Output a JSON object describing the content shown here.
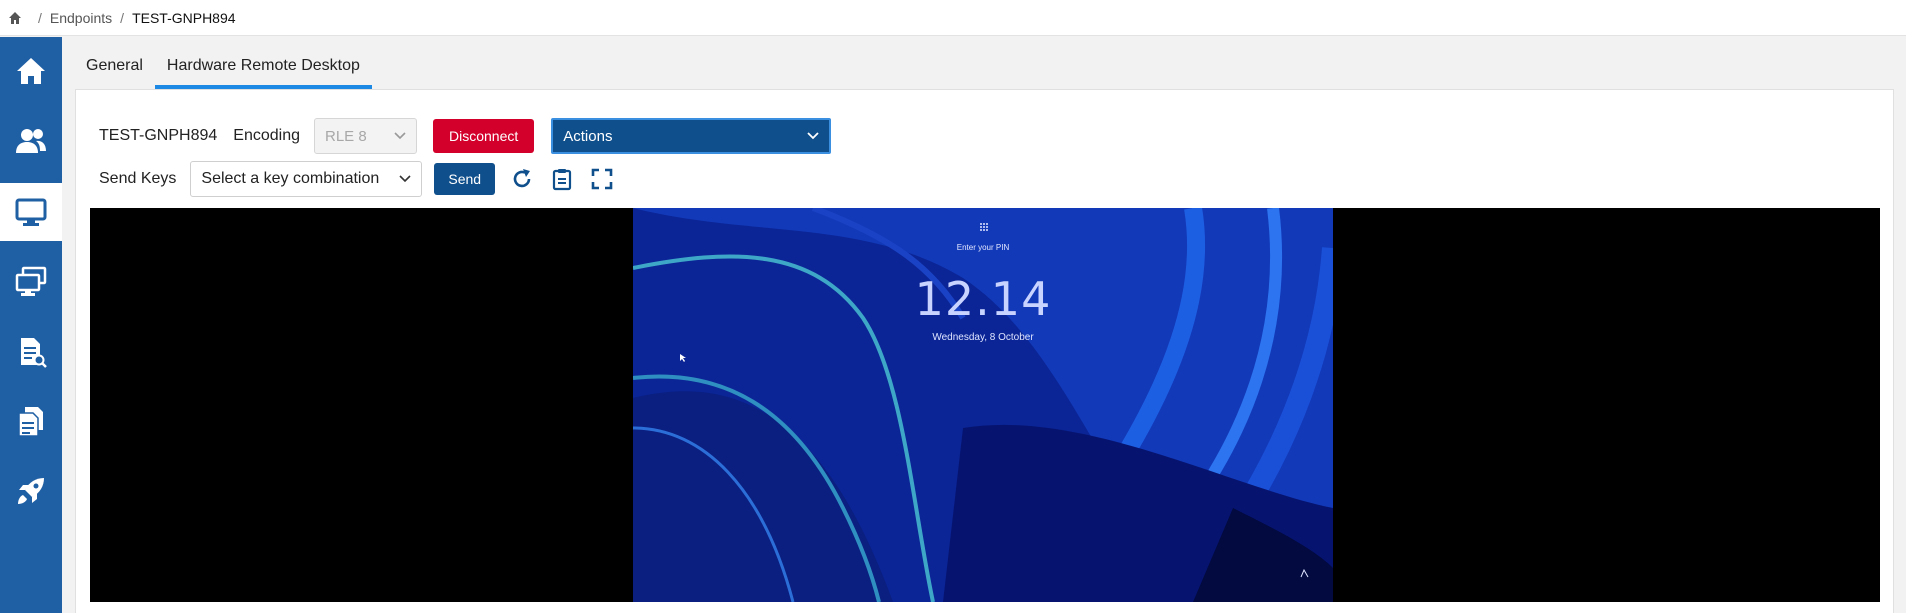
{
  "breadcrumb": {
    "home_icon": "home-icon",
    "items": [
      "Endpoints",
      "TEST-GNPH894"
    ],
    "separator": "/"
  },
  "sidebar": {
    "items": [
      {
        "icon": "home-icon",
        "active": false
      },
      {
        "icon": "users-icon",
        "active": false
      },
      {
        "icon": "monitor-icon",
        "active": true
      },
      {
        "icon": "multiple-monitors-icon",
        "active": false
      },
      {
        "icon": "document-search-icon",
        "active": false
      },
      {
        "icon": "copy-documents-icon",
        "active": false
      },
      {
        "icon": "rocket-icon",
        "active": false
      }
    ],
    "color": "#1f5fa3"
  },
  "tabs": [
    {
      "label": "General",
      "active": false
    },
    {
      "label": "Hardware Remote Desktop",
      "active": true
    }
  ],
  "toolbar": {
    "device_name": "TEST-GNPH894",
    "encoding_label": "Encoding",
    "encoding_value": "RLE 8",
    "disconnect_label": "Disconnect",
    "actions_label": "Actions",
    "send_keys_label": "Send Keys",
    "key_combo_placeholder": "Select a key combination",
    "send_label": "Send",
    "icons": [
      "refresh-icon",
      "clipboard-icon",
      "fullscreen-icon"
    ]
  },
  "remote_screen": {
    "pin_prompt": "Enter your PIN",
    "time": "12.14",
    "date": "Wednesday, 8 October"
  },
  "colors": {
    "accent": "#1e88e5",
    "primary": "#0f4f8c",
    "danger": "#d2002b"
  }
}
